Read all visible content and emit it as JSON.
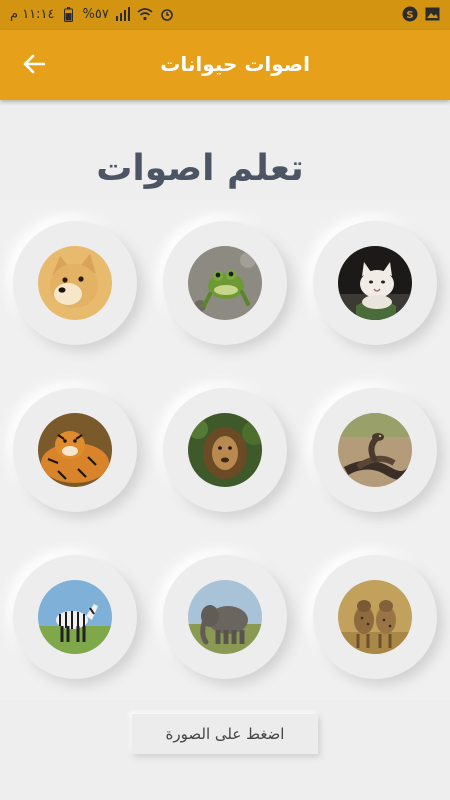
{
  "status_bar": {
    "time": "١١:١٤ م",
    "battery": "%٥٧",
    "icons": [
      "battery-icon",
      "signal-icon",
      "wifi-icon",
      "alarm-icon",
      "app-s-icon",
      "gallery-icon"
    ]
  },
  "app_bar": {
    "title": "اصوات حيوانات",
    "back_icon": "arrow-back-icon",
    "color": "#e6a019"
  },
  "heading": "تعلم اصوات",
  "animals": [
    {
      "name": "cat",
      "icon": "cat-photo"
    },
    {
      "name": "frog",
      "icon": "frog-photo"
    },
    {
      "name": "dog",
      "icon": "dog-photo"
    },
    {
      "name": "snake",
      "icon": "snake-photo"
    },
    {
      "name": "lion",
      "icon": "lion-photo"
    },
    {
      "name": "tiger",
      "icon": "tiger-photo"
    },
    {
      "name": "hyena",
      "icon": "hyena-photo"
    },
    {
      "name": "elephant",
      "icon": "elephant-photo"
    },
    {
      "name": "zebra",
      "icon": "zebra-photo"
    }
  ],
  "hint_button": "اضغط على الصورة"
}
